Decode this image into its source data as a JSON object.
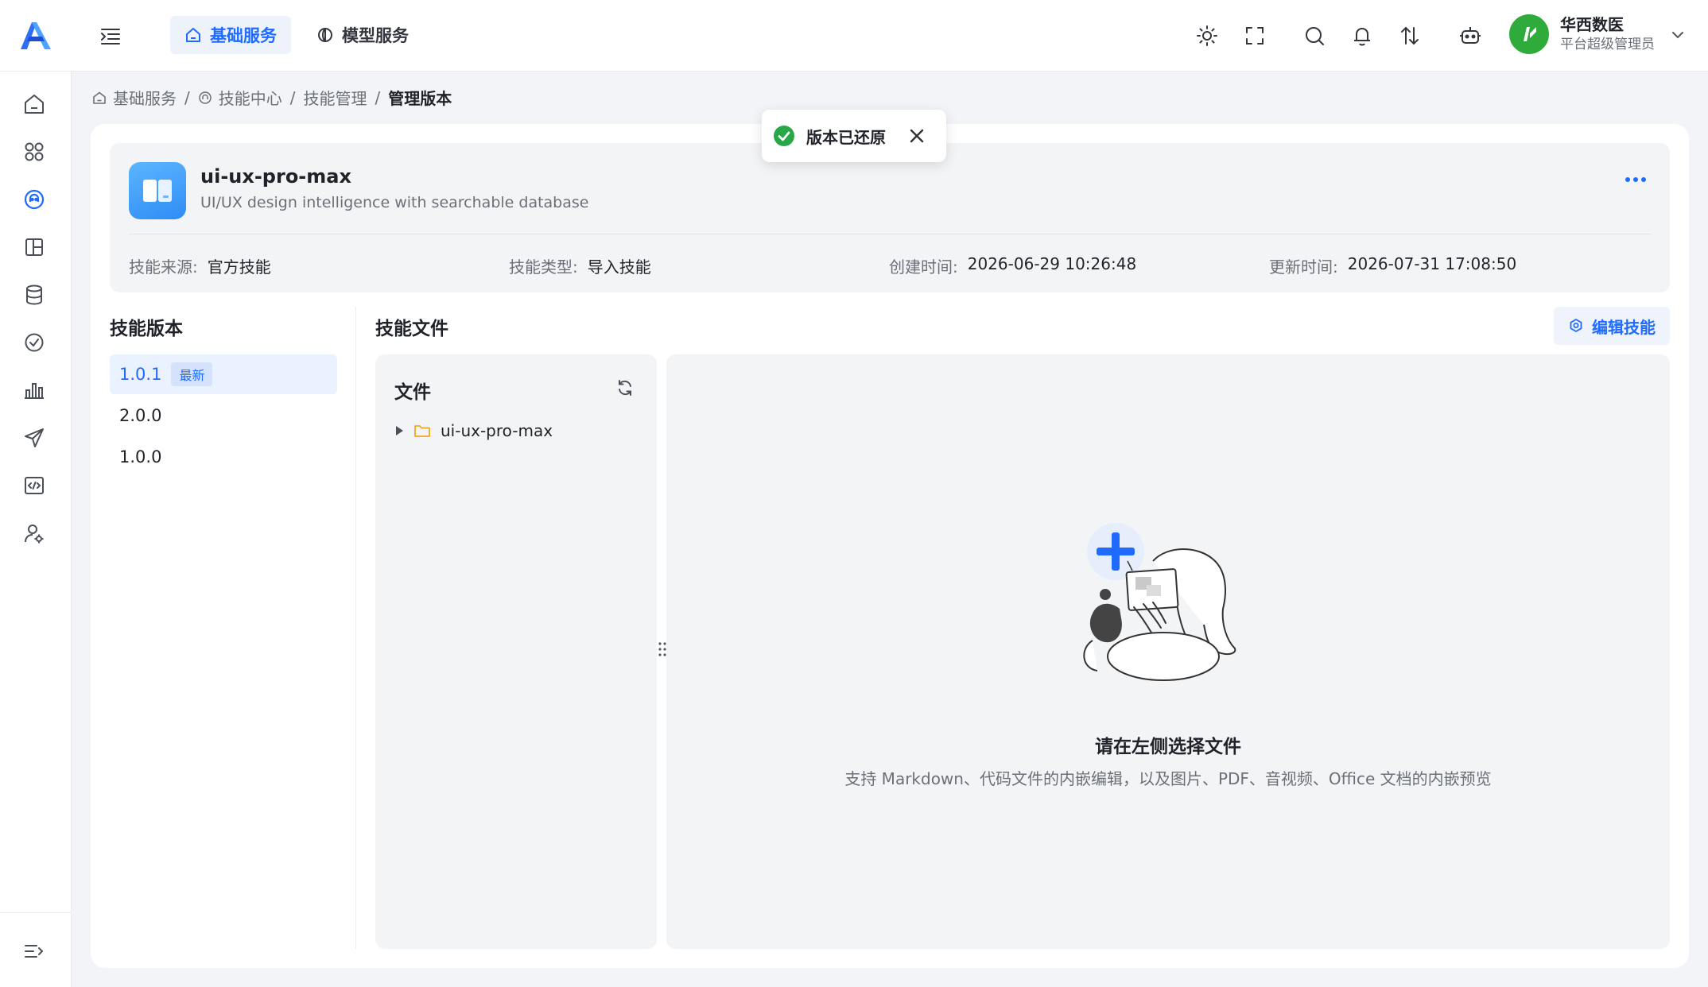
{
  "header": {
    "nav_tabs": [
      {
        "label": "基础服务",
        "icon": "home-icon",
        "active": true
      },
      {
        "label": "模型服务",
        "icon": "model-icon",
        "active": false
      }
    ],
    "icons": [
      "sun-icon",
      "fullscreen-icon",
      "search-icon",
      "bell-icon",
      "sort-icon",
      "robot-icon"
    ],
    "user": {
      "name": "华西数医",
      "role": "平台超级管理员"
    }
  },
  "sidebar": {
    "items": [
      "home-icon",
      "apps-icon",
      "skill-center-icon",
      "layout-icon",
      "database-icon",
      "check-icon",
      "chart-icon",
      "send-icon",
      "code-icon",
      "user-settings-icon"
    ],
    "active_index": 2
  },
  "breadcrumb": {
    "items": [
      "基础服务",
      "技能中心",
      "技能管理"
    ],
    "current": "管理版本"
  },
  "toast": {
    "message": "版本已还原"
  },
  "skill": {
    "name": "ui-ux-pro-max",
    "description": "UI/UX design intelligence with searchable database",
    "meta": [
      {
        "key": "技能来源:",
        "value": "官方技能"
      },
      {
        "key": "技能类型:",
        "value": "导入技能"
      },
      {
        "key": "创建时间:",
        "value": "2026-06-29 10:26:48"
      },
      {
        "key": "更新时间:",
        "value": "2026-07-31 17:08:50"
      }
    ]
  },
  "versions": {
    "title": "技能版本",
    "items": [
      {
        "label": "1.0.1",
        "badge": "最新",
        "active": true
      },
      {
        "label": "2.0.0",
        "badge": "",
        "active": false
      },
      {
        "label": "1.0.0",
        "badge": "",
        "active": false
      }
    ]
  },
  "files": {
    "title": "技能文件",
    "edit_label": "编辑技能",
    "tree_title": "文件",
    "root_folder": "ui-ux-pro-max"
  },
  "preview": {
    "empty_title": "请在左侧选择文件",
    "empty_desc": "支持 Markdown、代码文件的内嵌编辑，以及图片、PDF、音视频、Office 文档的内嵌预览"
  },
  "colors": {
    "primary": "#1f6bff",
    "success": "#27a745",
    "folder": "#f5a524"
  }
}
